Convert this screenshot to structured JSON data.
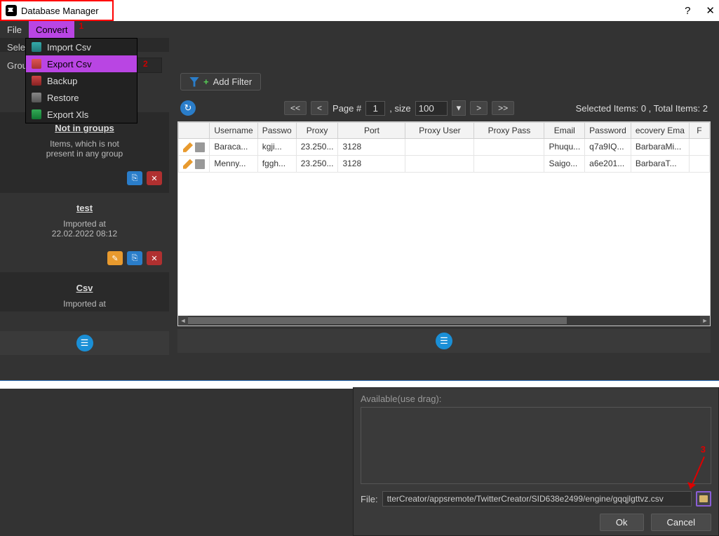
{
  "window": {
    "title": "Database Manager",
    "help": "?",
    "close": "✕"
  },
  "menu": {
    "file": "File",
    "convert": "Convert"
  },
  "annotations": {
    "one": "1",
    "two": "2",
    "three": "3"
  },
  "convert_menu": {
    "import_csv": "Import Csv",
    "export_csv": "Export Csv",
    "backup": "Backup",
    "restore": "Restore",
    "export_xls": "Export Xls"
  },
  "sidebar": {
    "select_label": "Sele",
    "group_label": "Group",
    "groups": [
      {
        "title": "Not in groups",
        "sub1": "Items, which is not",
        "sub2": "present in any group"
      },
      {
        "title": "test",
        "sub1": "Imported at",
        "sub2": "22.02.2022 08:12"
      },
      {
        "title": "Csv",
        "sub1": "Imported at",
        "sub2": ""
      }
    ]
  },
  "toolbar": {
    "add_filter": "Add Filter"
  },
  "pager": {
    "first": "<<",
    "prev": "<",
    "page_label": "Page #",
    "page": "1",
    "size_label": ", size",
    "size": "100",
    "next": ">",
    "last": ">>",
    "status_selected_label": "Selected Items:",
    "selected": "0",
    "status_total_label": ", Total Items:",
    "total": "2"
  },
  "table": {
    "cols": [
      "",
      "Username",
      "Passwo",
      "Proxy",
      "Port",
      "Proxy User",
      "Proxy Pass",
      "Email",
      "Password",
      "ecovery Ema",
      "F"
    ],
    "rows": [
      {
        "username": "Baraca...",
        "password": "kgji...",
        "proxy": "23.250...",
        "port": "3128",
        "proxy_user": "",
        "proxy_pass": "",
        "email": "Phuqu...",
        "epassword": "q7a9IQ...",
        "recovery": "BarbaraMi..."
      },
      {
        "username": "Menny...",
        "password": "fggh...",
        "proxy": "23.250...",
        "port": "3128",
        "proxy_user": "",
        "proxy_pass": "",
        "email": "Saigo...",
        "epassword": "a6e201...",
        "recovery": "BarbaraT..."
      }
    ]
  },
  "dialog": {
    "available": "Available(use drag):",
    "file_label": "File:",
    "file_path": "tterCreator/appsremote/TwitterCreator/SID638e2499/engine/gqqjlgttvz.csv",
    "ok": "Ok",
    "cancel": "Cancel"
  }
}
